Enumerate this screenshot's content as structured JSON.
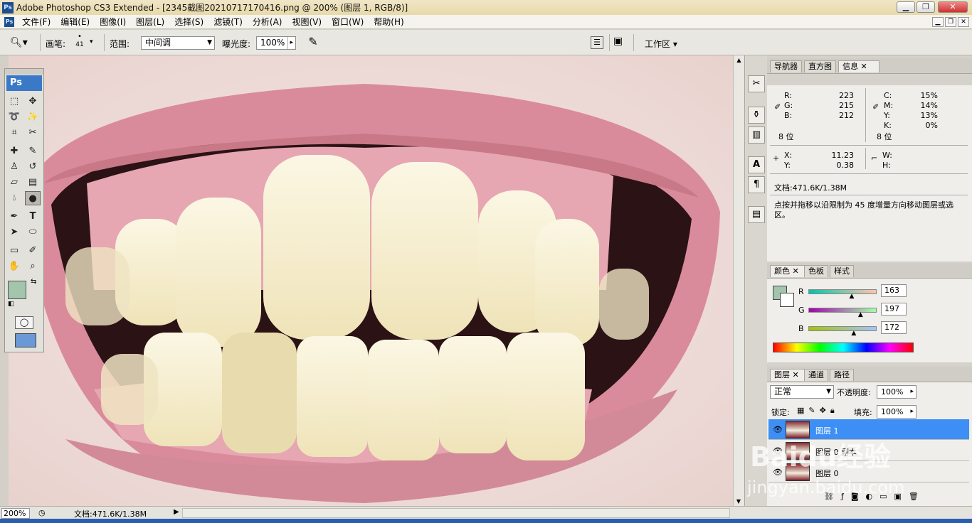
{
  "window": {
    "title": "Adobe Photoshop CS3 Extended - [2345截图20210717170416.png @ 200% (图层 1, RGB/8)]",
    "app_icon": "Ps",
    "min_label": "▁",
    "max_label": "❐",
    "close_label": "✕"
  },
  "menu": {
    "items": [
      "文件(F)",
      "编辑(E)",
      "图像(I)",
      "图层(L)",
      "选择(S)",
      "滤镜(T)",
      "分析(A)",
      "视图(V)",
      "窗口(W)",
      "帮助(H)"
    ],
    "doc_icon": "Ps"
  },
  "options": {
    "brush_label": "画笔:",
    "brush_size": "41",
    "range_label": "范围:",
    "range_value": "中间调",
    "exposure_label": "曝光度:",
    "exposure_value": "100%",
    "workspace_label": "工作区 ▾"
  },
  "toolbox": {
    "logo": "Ps",
    "fg_color": "#a3c5ac",
    "bg_color": "#ffffff"
  },
  "info_panel": {
    "tabs": [
      "导航器",
      "直方图",
      "信息"
    ],
    "r_label": "R:",
    "r_value": "223",
    "g_label": "G:",
    "g_value": "215",
    "b_label": "B:",
    "b_value": "212",
    "c_label": "C:",
    "c_value": "15%",
    "m_label": "M:",
    "m_value": "14%",
    "y_label": "Y:",
    "y_value": "13%",
    "k_label": "K:",
    "k_value": "0%",
    "bits_left": "8 位",
    "bits_right": "8 位",
    "x_label": "X:",
    "x_value": "11.23",
    "yy_label": "Y:",
    "yy_value": "0.38",
    "w_label": "W:",
    "h_label": "H:",
    "doc_size": "文档:471.6K/1.38M",
    "hint": "点按并拖移以沿限制为 45 度增量方向移动图层或选区。"
  },
  "color_panel": {
    "tabs": [
      "颜色",
      "色板",
      "样式"
    ],
    "r_label": "R",
    "r_value": "163",
    "g_label": "G",
    "g_value": "197",
    "b_label": "B",
    "b_value": "172",
    "r_fraction": 0.64,
    "g_fraction": 0.77,
    "b_fraction": 0.67,
    "swatch": "#a3c5ac"
  },
  "layers_panel": {
    "tabs": [
      "图层",
      "通道",
      "路径"
    ],
    "blend_mode": "正常",
    "opacity_label": "不透明度:",
    "opacity_value": "100%",
    "lock_label": "锁定:",
    "fill_label": "填充:",
    "fill_value": "100%",
    "layers": [
      {
        "name": "图层 1",
        "selected": true
      },
      {
        "name": "图层 0 副本",
        "selected": false
      },
      {
        "name": "图层 0",
        "selected": false
      }
    ]
  },
  "status": {
    "zoom": "200%",
    "doc": "文档:471.6K/1.38M"
  },
  "watermark": {
    "brand": "Baidu经验",
    "url": "jingyan.baidu.com"
  }
}
